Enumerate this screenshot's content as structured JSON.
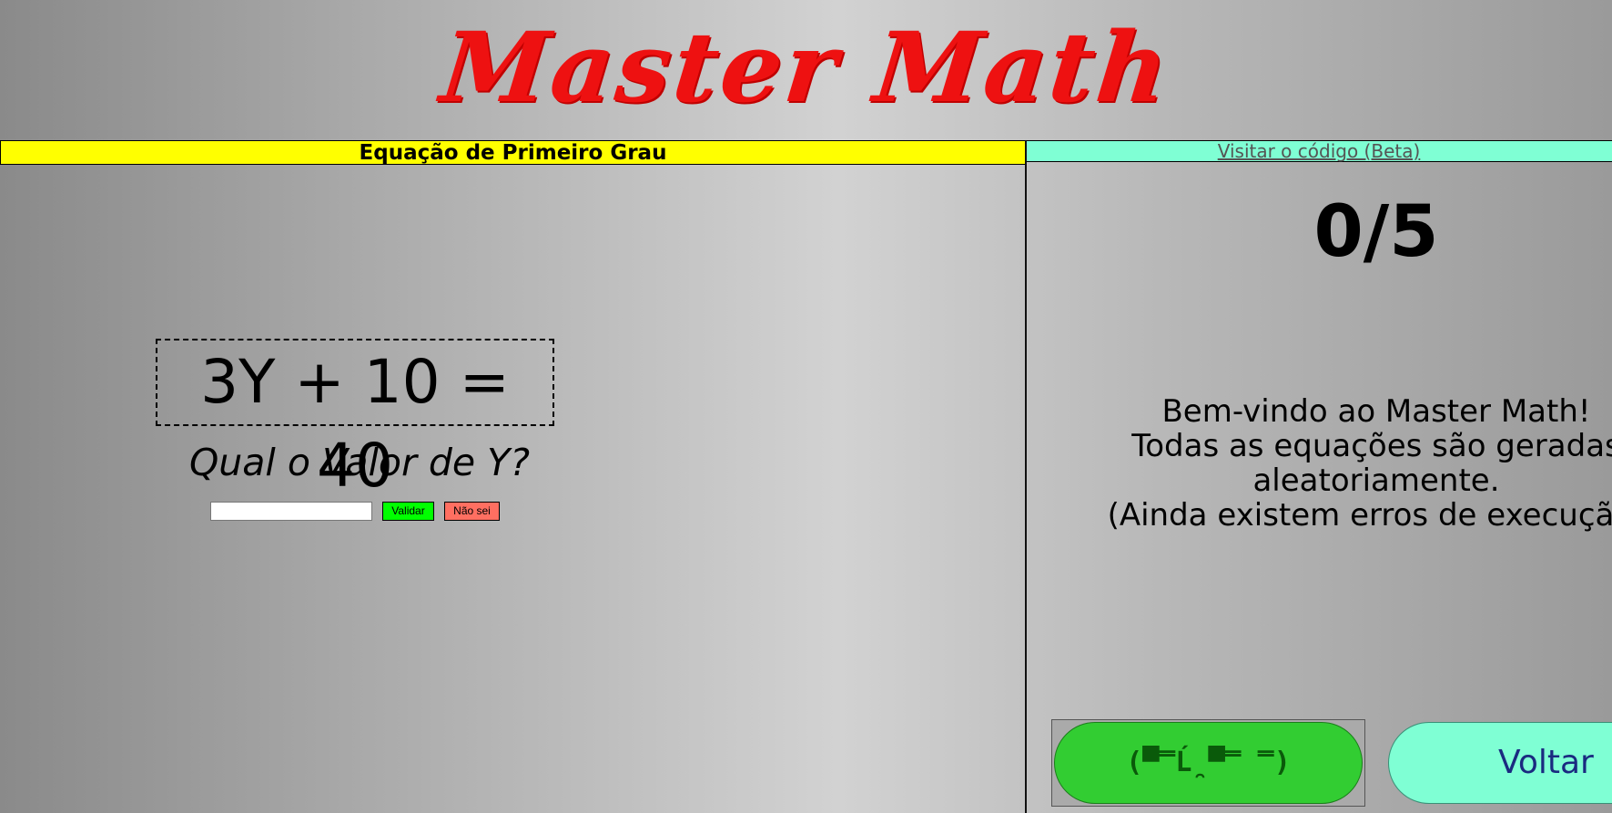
{
  "app": {
    "title": "Master Math"
  },
  "left_panel": {
    "header": "Equação de Primeiro Grau",
    "equation": "3Y + 10 = 40",
    "question": "Qual o Valor de Y?",
    "answer_input": {
      "value": "",
      "placeholder": ""
    },
    "validate_label": "Validar",
    "dont_know_label": "Não sei"
  },
  "right_panel": {
    "code_link": "Visitar o código (Beta)",
    "score": "0/5",
    "welcome_lines": [
      "Bem-vindo ao Master Math!",
      "Todas as equações são geradas",
      "aleatoriamente.",
      "(Ainda existem erros de execução)"
    ],
    "emoji_button_label": "(▀̿Ĺ̯▀̿ ̿)",
    "back_label": "Voltar"
  },
  "colors": {
    "title": "#ee1111",
    "left_header_bg": "#ffff00",
    "right_header_bg": "#7fffd4",
    "validate_bg": "#00ff00",
    "dont_know_bg": "#ff6f61",
    "emoji_button_bg": "#32cd32",
    "back_button_bg": "#7fffd4"
  }
}
